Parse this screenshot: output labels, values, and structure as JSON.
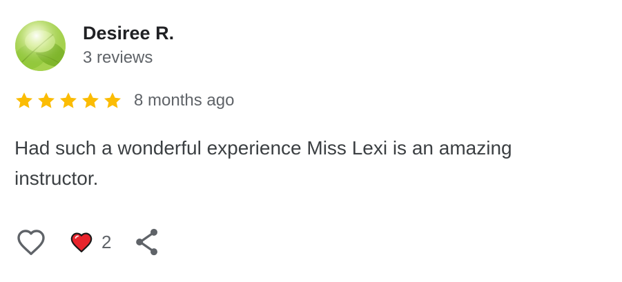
{
  "reviewer": {
    "name": "Desiree R.",
    "review_count": "3 reviews",
    "avatar_icon": "leaf-photo-avatar"
  },
  "rating": {
    "stars": 5,
    "max_stars": 5,
    "date": "8 months ago",
    "star_color": "#FBBC04"
  },
  "review": {
    "text": "Had such a wonderful experience Miss Lexi is an amazing instructor."
  },
  "actions": {
    "like_icon": "heart-outline-icon",
    "reaction_icon": "red-heart-icon",
    "reaction_count": "2",
    "share_icon": "share-icon",
    "reaction_color": "#E8242C"
  }
}
